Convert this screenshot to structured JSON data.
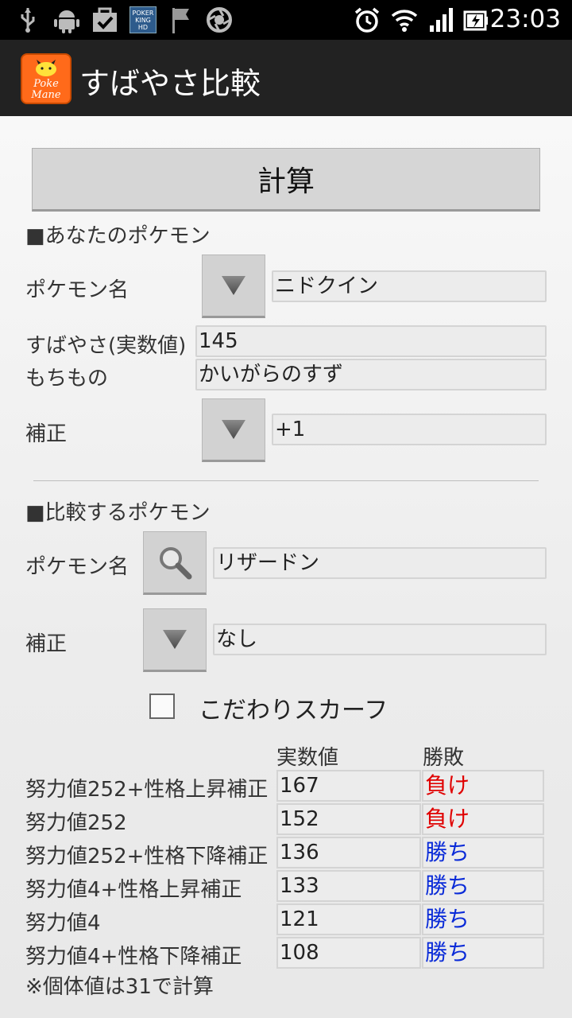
{
  "status_bar": {
    "time": "23:03",
    "icons": [
      "usb-icon",
      "android-icon",
      "task-check-icon",
      "poker-app-icon",
      "flag-icon",
      "camera-aperture-icon",
      "alarm-icon",
      "wifi-icon",
      "signal-icon",
      "battery-icon"
    ],
    "poker_icon_text": "POKER KING HD"
  },
  "action_bar": {
    "title": "すばやさ比較",
    "logo_line1": "Poke",
    "logo_line2": "Mane"
  },
  "calc_button": "計算",
  "your_pokemon": {
    "section_title": "■あなたのポケモン",
    "name_label": "ポケモン名",
    "name_value": "ニドクイン",
    "speed_label": "すばやさ(実数値)",
    "speed_value": "145",
    "item_label": "もちもの",
    "item_value": "かいがらのすず",
    "mod_label": "補正",
    "mod_value": "+1"
  },
  "compare_pokemon": {
    "section_title": "■比較するポケモン",
    "name_label": "ポケモン名",
    "name_value": "リザードン",
    "mod_label": "補正",
    "mod_value": "なし",
    "scarf_label": "こだわりスカーフ",
    "scarf_checked": false
  },
  "results": {
    "col_value": "実数値",
    "col_result": "勝敗",
    "lose_color": "#e00000",
    "win_color": "#0a2bd8",
    "rows": [
      {
        "label": "努力値252+性格上昇補正",
        "value": "167",
        "result": "負け",
        "win": false
      },
      {
        "label": "努力値252",
        "value": "152",
        "result": "負け",
        "win": false
      },
      {
        "label": "努力値252+性格下降補正",
        "value": "136",
        "result": "勝ち",
        "win": true
      },
      {
        "label": "努力値4+性格上昇補正",
        "value": "133",
        "result": "勝ち",
        "win": true
      },
      {
        "label": "努力値4",
        "value": "121",
        "result": "勝ち",
        "win": true
      },
      {
        "label": "努力値4+性格下降補正",
        "value": "108",
        "result": "勝ち",
        "win": true
      }
    ],
    "note": "※個体値は31で計算"
  }
}
